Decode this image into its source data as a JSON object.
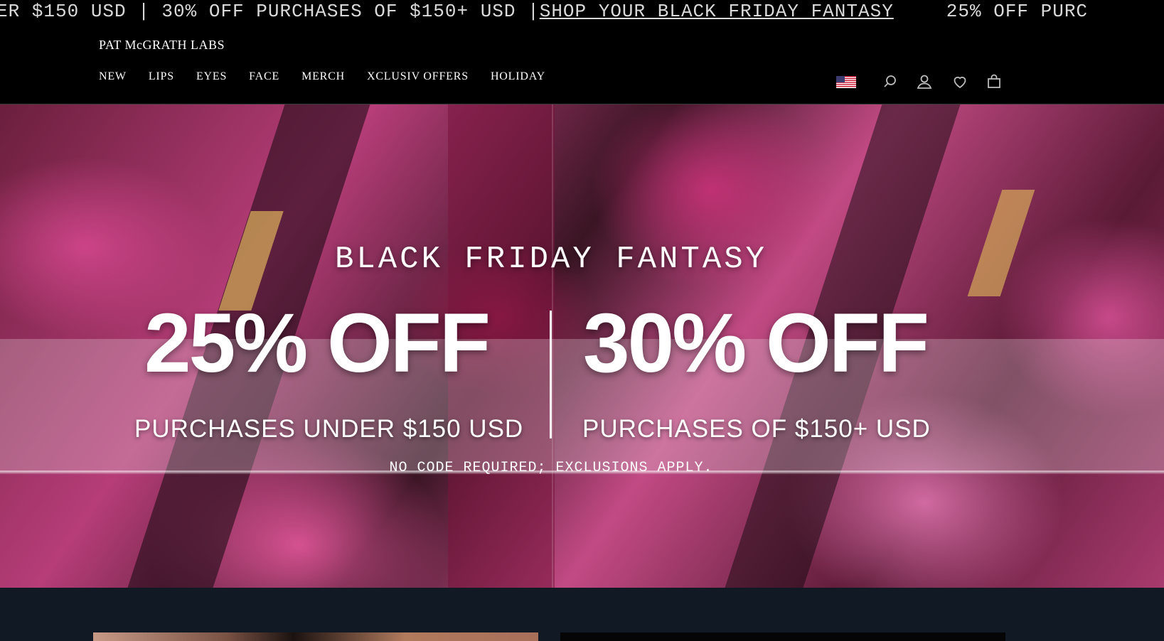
{
  "announcement": {
    "segments": [
      "ER $150 USD | 30% OFF PURCHASES OF $150+ USD | ",
      "25% OFF PURC"
    ],
    "link_label": "SHOP YOUR BLACK FRIDAY FANTASY"
  },
  "header": {
    "brand": "PAT McGRATH LABS",
    "nav": [
      "NEW",
      "LIPS",
      "EYES",
      "FACE",
      "MERCH",
      "XCLUSIV OFFERS",
      "HOLIDAY"
    ],
    "utility_icons": [
      "us-flag-icon",
      "search-icon",
      "account-icon",
      "wishlist-heart-icon",
      "shopping-bag-icon"
    ]
  },
  "hero": {
    "title": "BLACK FRIDAY FANTASY",
    "offers": [
      {
        "headline": "25% OFF",
        "subline": "PURCHASES UNDER $150 USD"
      },
      {
        "headline": "30% OFF",
        "subline": "PURCHASES OF $150+ USD"
      }
    ],
    "note": "NO CODE REQUIRED; EXCLUSIONS APPLY."
  },
  "colors": {
    "page_background": "#000000",
    "lower_section": "#111a24",
    "text": "#ffffff",
    "hero_pink": "#c24a84"
  }
}
